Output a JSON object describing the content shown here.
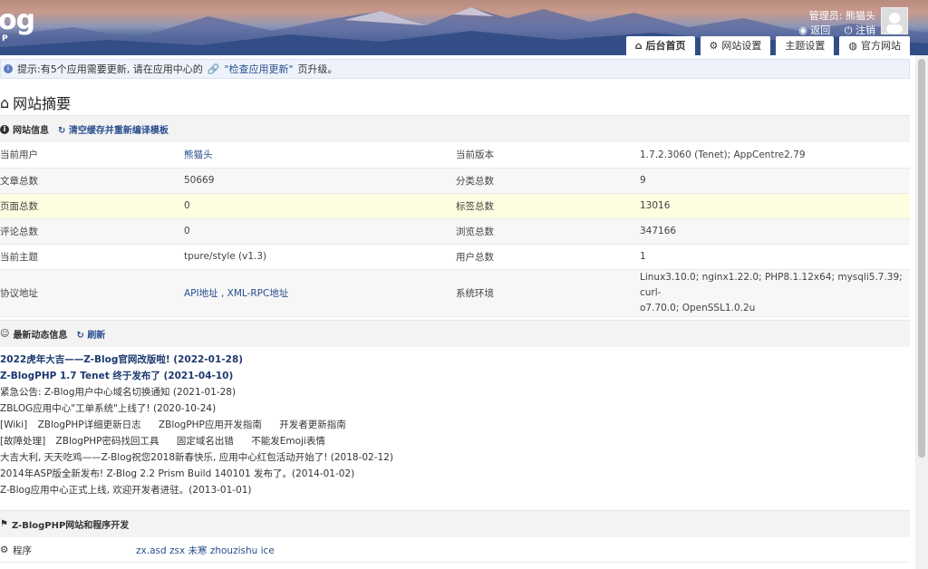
{
  "header": {
    "logo_text": "og",
    "logo_sub": "P",
    "user_label": "管理员: 熊猫头",
    "back_label": "返回",
    "logout_label": "注销",
    "nav_tabs": [
      {
        "label": "后台首页",
        "icon": "home-icon"
      },
      {
        "label": "网站设置",
        "icon": "gear-icon"
      },
      {
        "label": "主题设置",
        "icon": ""
      },
      {
        "label": "官方网站",
        "icon": "globe-icon"
      }
    ]
  },
  "notice": {
    "prefix": "提示:有5个应用需要更新, 请在应用中心的",
    "link": "\"检查应用更新\"",
    "suffix": "页升级。"
  },
  "page_title": "网站摘要",
  "site_info": {
    "heading": "网站信息",
    "clear_cache_link": "清空缓存并重新编译模板",
    "rows": [
      {
        "k1": "当前用户",
        "v1": "熊猫头",
        "k2": "当前版本",
        "v2": "1.7.2.3060 (Tenet); AppCentre2.79"
      },
      {
        "k1": "文章总数",
        "v1": "50669",
        "k2": "分类总数",
        "v2": "9"
      },
      {
        "k1": "页面总数",
        "v1": "0",
        "k2": "标签总数",
        "v2": "13016"
      },
      {
        "k1": "评论总数",
        "v1": "0",
        "k2": "浏览总数",
        "v2": "347166"
      },
      {
        "k1": "当前主题",
        "v1": "tpure/style (v1.3)",
        "k2": "用户总数",
        "v2": "1"
      },
      {
        "k1": "协议地址",
        "v1a": "API地址",
        "sep": ",",
        "v1b": "XML-RPC地址",
        "k2": "系统环境",
        "v2a": "Linux3.10.0; nginx1.22.0; PHP8.1.12x64; mysqli5.7.39; curl-",
        "v2b": "o7.70.0; OpenSSL1.0.2u"
      }
    ]
  },
  "news": {
    "heading": "最新动态信息",
    "refresh_link": "刷新",
    "lines": [
      "2022虎年大吉——Z-Blog官网改版啦! (2022-01-28)",
      "Z-BlogPHP 1.7 Tenet 终于发布了 (2021-04-10)",
      "紧急公告: Z-Blog用户中心域名切换通知 (2021-01-28)",
      "ZBLOG应用中心\"工单系统\"上线了! (2020-10-24)",
      "大吉大利, 天天吃鸡——Z-Blog祝您2018新春快乐, 应用中心红包活动开始了! (2018-02-12)",
      "2014年ASP版全新发布! Z-Blog 2.2 Prism Build 140101 发布了。(2014-01-02)",
      "Z-Blog应用中心正式上线, 欢迎开发者进驻。(2013-01-01)"
    ],
    "wiki": {
      "tag": "[Wiki]",
      "items": [
        "ZBlogPHP详细更新日志",
        "ZBlogPHP应用开发指南",
        "开发者更新指南"
      ]
    },
    "fault": {
      "tag": "[故障处理]",
      "items": [
        "ZBlogPHP密码找回工具",
        "固定域名出错",
        "不能发Emoji表情"
      ]
    }
  },
  "dev": {
    "heading": "Z-BlogPHP网站和程序开发",
    "row_label": "程序",
    "row_value": "zx.asd zsx 未寒 zhouzishu ice"
  }
}
